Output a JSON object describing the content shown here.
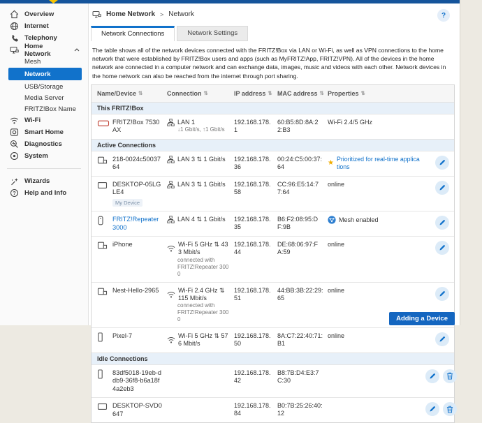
{
  "header": {
    "breadcrumb": [
      {
        "label": "Home Network"
      },
      {
        "label": "Network"
      }
    ],
    "separator": ">",
    "help_label": "?"
  },
  "tabs": [
    {
      "label": "Network Connections",
      "active": true
    },
    {
      "label": "Network Settings",
      "active": false
    }
  ],
  "description": "The table shows all of the network devices connected with the FRITZ!Box via LAN or Wi-Fi, as well as VPN connections to the home network that were established by FRITZ!Box users and apps (such as MyFRITZ!App, FRITZ!VPN). All of the devices in the home network are connected in a computer network and can exchange data, images, music and videos with each other. Network devices in the home network can also be reached from the internet through port sharing.",
  "sidebar": {
    "items": [
      {
        "label": "Overview",
        "icon": "home-icon"
      },
      {
        "label": "Internet",
        "icon": "globe-icon"
      },
      {
        "label": "Telephony",
        "icon": "phone-icon"
      },
      {
        "label": "Home Network",
        "icon": "home-network-icon",
        "expanded": true,
        "children": [
          {
            "label": "Mesh"
          },
          {
            "label": "Network",
            "selected": true
          },
          {
            "label": "USB/Storage"
          },
          {
            "label": "Media Server"
          },
          {
            "label": "FRITZ!Box Name"
          }
        ]
      },
      {
        "label": "Wi-Fi",
        "icon": "wifi-icon"
      },
      {
        "label": "Smart Home",
        "icon": "smart-home-icon"
      },
      {
        "label": "Diagnostics",
        "icon": "diagnostics-icon"
      },
      {
        "label": "System",
        "icon": "system-icon"
      }
    ],
    "footer_items": [
      {
        "label": "Wizards",
        "icon": "wizard-icon"
      },
      {
        "label": "Help and Info",
        "icon": "help-icon"
      }
    ]
  },
  "table": {
    "columns": [
      "Name/Device",
      "Connection",
      "IP address",
      "MAC address",
      "Properties"
    ],
    "sort_glyph": "⇅",
    "sections": [
      {
        "title": "This FRITZ!Box",
        "rows": [
          {
            "icon": "router-device-icon",
            "name": "FRITZ!Box 7530 AX",
            "conn": {
              "icon": "lan-icon",
              "text": "LAN 1",
              "sub": [
                "↓1 Gbit/s, ↑1 Gbit/s"
              ]
            },
            "ip": "192.168.178.1",
            "mac": "60:B5:8D:8A:22:B3",
            "prop": {
              "type": "text",
              "text": "Wi-Fi 2.4/5 GHz"
            },
            "actions": []
          }
        ]
      },
      {
        "title": "Active Connections",
        "rows": [
          {
            "icon": "generic-device-icon",
            "name": "218-0024c5003764",
            "conn": {
              "icon": "lan-icon",
              "text": "LAN 3 ⇅ 1 Gbit/s",
              "sub": []
            },
            "ip": "192.168.178.36",
            "mac": "00:24:C5:00:37:64",
            "prop": {
              "type": "priority",
              "text": "Prioritized for real-time applications"
            },
            "actions": [
              "edit"
            ]
          },
          {
            "icon": "desktop-device-icon",
            "name": "DESKTOP-05LGLE4",
            "badge": "My Device",
            "conn": {
              "icon": "lan-icon",
              "text": "LAN 3 ⇅ 1 Gbit/s",
              "sub": []
            },
            "ip": "192.168.178.58",
            "mac": "CC:96:E5:14:77:64",
            "prop": {
              "type": "text",
              "text": "online"
            },
            "actions": [
              "edit"
            ]
          },
          {
            "icon": "repeater-device-icon",
            "name": "FRITZ!Repeater 3000",
            "link": true,
            "conn": {
              "icon": "lan-icon",
              "text": "LAN 4 ⇅ 1 Gbit/s",
              "sub": []
            },
            "ip": "192.168.178.35",
            "mac": "B6:F2:08:95:DF:9B",
            "prop": {
              "type": "mesh",
              "text": "Mesh enabled"
            },
            "actions": [
              "edit"
            ]
          },
          {
            "icon": "mobile-device-icon",
            "name": "iPhone",
            "conn": {
              "icon": "wifi-conn-icon",
              "text": "Wi-Fi 5 GHz ⇅ 433 Mbit/s",
              "sub": [
                "connected with",
                "FRITZ!Repeater 3000"
              ]
            },
            "ip": "192.168.178.44",
            "mac": "DE:68:06:97:FA:59",
            "prop": {
              "type": "text",
              "text": "online"
            },
            "actions": [
              "edit"
            ]
          },
          {
            "icon": "mobile-device-icon",
            "name": "Nest-Hello-2965",
            "conn": {
              "icon": "wifi-conn-icon",
              "text": "Wi-Fi 2.4 GHz ⇅ 115 Mbit/s",
              "sub": [
                "connected with",
                "FRITZ!Repeater 3000"
              ]
            },
            "ip": "192.168.178.51",
            "mac": "44:BB:3B:22:29:65",
            "prop": {
              "type": "text",
              "text": "online"
            },
            "actions": [
              "edit"
            ]
          },
          {
            "icon": "phone-device-icon",
            "name": "Pixel-7",
            "conn": {
              "icon": "wifi-conn-icon",
              "text": "Wi-Fi 5 GHz ⇅ 576 Mbit/s",
              "sub": []
            },
            "ip": "192.168.178.50",
            "mac": "8A:C7:22:40:71:B1",
            "prop": {
              "type": "text",
              "text": "online"
            },
            "actions": [
              "edit"
            ]
          }
        ]
      },
      {
        "title": "Idle Connections",
        "rows": [
          {
            "icon": "phone-device-icon",
            "name": "83df5018-19eb-ddb9-36f8-b6a18f4a2eb3",
            "conn": null,
            "ip": "192.168.178.42",
            "mac": "B8:7B:D4:E3:7C:30",
            "prop": null,
            "actions": [
              "edit",
              "delete"
            ]
          },
          {
            "icon": "desktop-device-icon",
            "name": "DESKTOP-SVD0647",
            "conn": null,
            "ip": "192.168.178.84",
            "mac": "B0:7B:25:26:40:12",
            "prop": null,
            "actions": [
              "edit",
              "delete"
            ]
          }
        ]
      }
    ]
  },
  "add_device_button": "Adding a Device",
  "colors": {
    "accent": "#1172CB",
    "topbar": "#15549B",
    "logo_yellow": "#F6C200",
    "star": "#F0AD00",
    "section_bg": "#E7F0F9",
    "button_blue": "#1466C0",
    "page_background": "#EDEAE2"
  }
}
